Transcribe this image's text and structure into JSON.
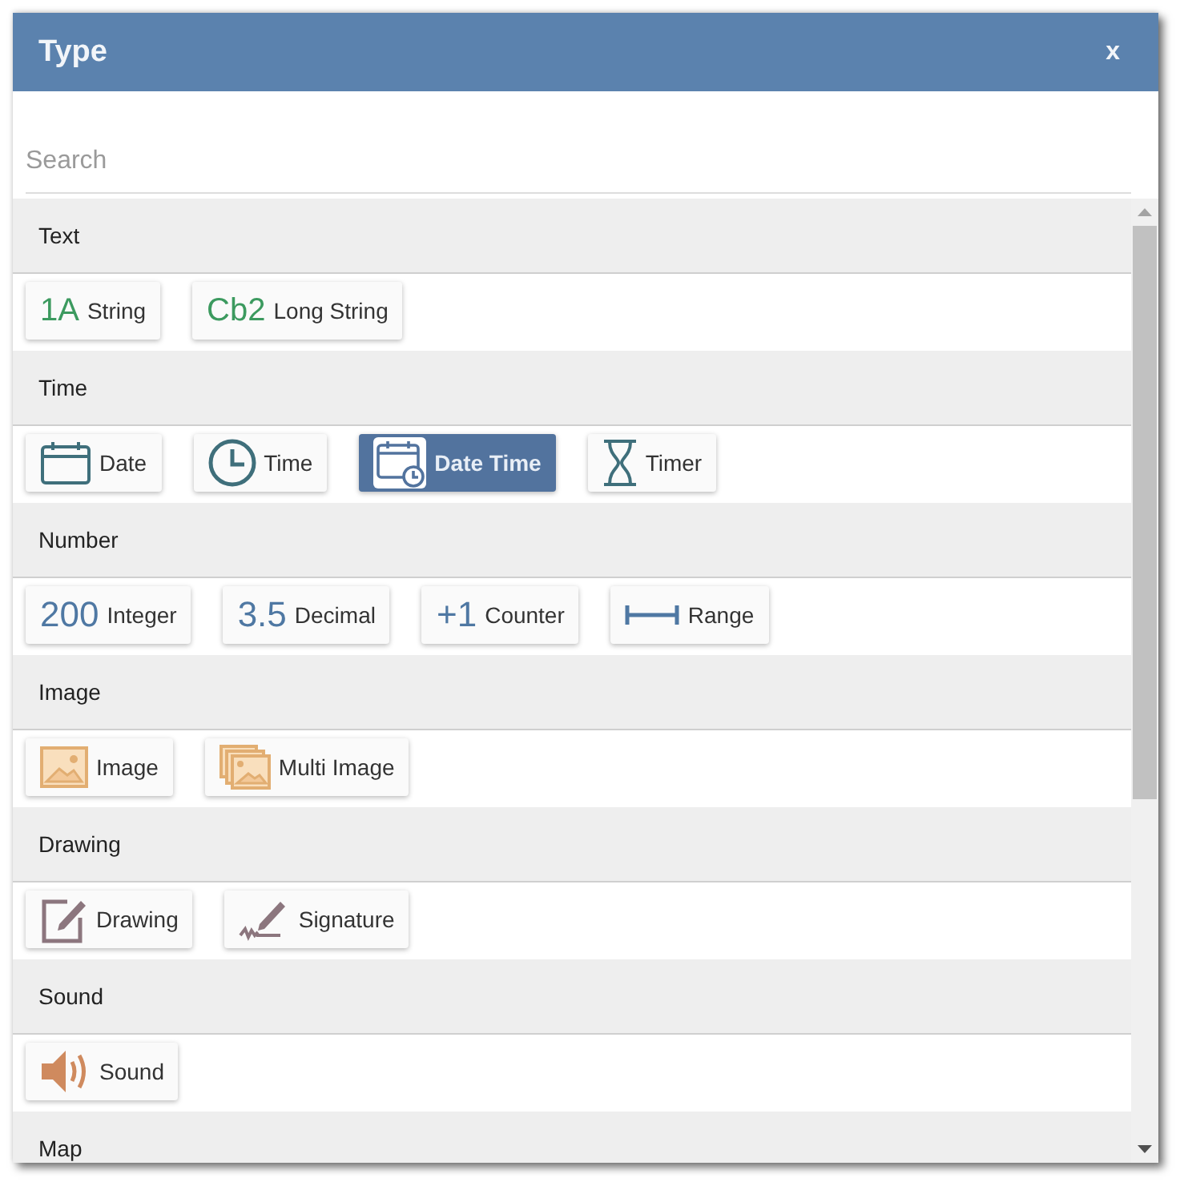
{
  "dialog": {
    "title": "Type",
    "close_label": "x"
  },
  "search": {
    "placeholder": "Search"
  },
  "sections": [
    {
      "title": "Text",
      "items": [
        {
          "label": "String",
          "kind": "textglyph",
          "glyph": "1A",
          "selected": false
        },
        {
          "label": "Long String",
          "kind": "textglyph",
          "glyph": "Cb2",
          "selected": false
        }
      ]
    },
    {
      "title": "Time",
      "items": [
        {
          "label": "Date",
          "kind": "date",
          "selected": false
        },
        {
          "label": "Time",
          "kind": "clock",
          "selected": false
        },
        {
          "label": "Date Time",
          "kind": "datetime",
          "selected": true
        },
        {
          "label": "Timer",
          "kind": "timer",
          "selected": false
        }
      ]
    },
    {
      "title": "Number",
      "items": [
        {
          "label": "Integer",
          "kind": "numberglyph",
          "glyph": "200",
          "selected": false
        },
        {
          "label": "Decimal",
          "kind": "numberglyph",
          "glyph": "3.5",
          "selected": false
        },
        {
          "label": "Counter",
          "kind": "numberglyph",
          "glyph": "+1",
          "selected": false
        },
        {
          "label": "Range",
          "kind": "range",
          "selected": false
        }
      ]
    },
    {
      "title": "Image",
      "items": [
        {
          "label": "Image",
          "kind": "image",
          "selected": false
        },
        {
          "label": "Multi Image",
          "kind": "multiimage",
          "selected": false
        }
      ]
    },
    {
      "title": "Drawing",
      "items": [
        {
          "label": "Drawing",
          "kind": "drawing",
          "selected": false
        },
        {
          "label": "Signature",
          "kind": "signature",
          "selected": false
        }
      ]
    },
    {
      "title": "Sound",
      "items": [
        {
          "label": "Sound",
          "kind": "sound",
          "selected": false
        }
      ]
    },
    {
      "title": "Map"
    }
  ]
}
